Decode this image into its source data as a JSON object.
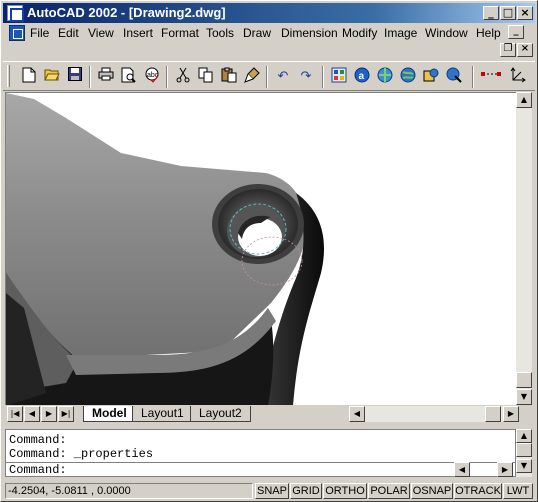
{
  "window": {
    "title": "AutoCAD 2002 - [Drawing2.dwg]",
    "minimize": "_",
    "maximize": "□",
    "close": "×"
  },
  "menu": {
    "items": [
      "File",
      "Edit",
      "View",
      "Insert",
      "Format",
      "Tools",
      "Draw",
      "Dimension",
      "Modify",
      "Image",
      "Window",
      "Help"
    ],
    "doc_minimize": "_",
    "doc_restore": "❐",
    "doc_close": "×"
  },
  "toolbar": {
    "icons": [
      "new-icon",
      "open-icon",
      "save-icon",
      "print-icon",
      "print-preview-icon",
      "spell-check-icon",
      "cut-icon",
      "copy-icon",
      "paste-icon",
      "match-properties-icon",
      "undo-icon",
      "redo-icon",
      "cad-standards-icon",
      "autocad-today-icon",
      "meet-now-icon",
      "publish-to-web-icon",
      "etransmit-icon",
      "tracking-icon",
      "ucs-icon"
    ]
  },
  "layout_tabs": {
    "tabs": [
      "Model",
      "Layout1",
      "Layout2"
    ],
    "active": "Model"
  },
  "command": {
    "history": [
      "Command:",
      "Command: _properties"
    ],
    "prompt": "Command:"
  },
  "status": {
    "coordinates": "-4.2504, -5.0811 , 0.0000",
    "toggles": [
      "SNAP",
      "GRID",
      "ORTHO",
      "POLAR",
      "OSNAP",
      "OTRACK",
      "LWT"
    ]
  },
  "colors": {
    "titlebar_start": "#0a246a",
    "titlebar_end": "#a6caf0",
    "chrome": "#d4d0c8",
    "drawing_background": "#ffffff",
    "solid_shade": "#8c8c8c"
  }
}
